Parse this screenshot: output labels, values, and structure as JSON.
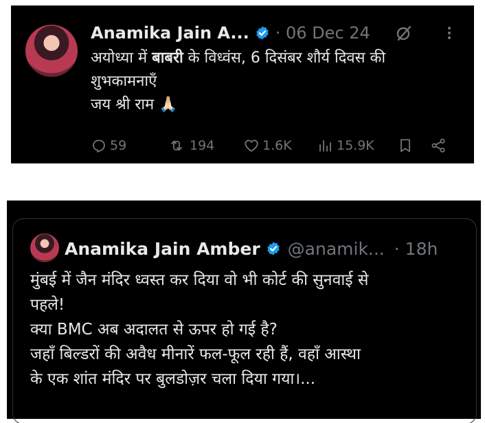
{
  "tweet1": {
    "display_name": "Anamika Jain A...",
    "dot_date": "· 06 Dec 24",
    "text_line1_pre": "अयोध्या में ",
    "text_line1_bold": "बाबरी",
    "text_line1_post": " के विध्वंस, 6 दिसंबर शौर्य दिवस की",
    "text_line2": "शुभकामनाएँ",
    "text_line3": "जय श्री राम 🙏🏻",
    "replies": "59",
    "reposts": "194",
    "likes": "1.6K",
    "views": "15.9K",
    "icons": {
      "reply": "reply-icon",
      "repost": "repost-icon",
      "like": "heart-icon",
      "views": "views-chart-icon",
      "bookmark": "bookmark-icon",
      "share": "share-icon",
      "grok": "grok-icon",
      "more": "more-icon",
      "verified": "verified-badge-icon"
    }
  },
  "tweet2": {
    "display_name": "Anamika Jain Amber",
    "handle": "@anamik...",
    "dot_date": "· 18h",
    "text_lines": [
      "मुंबई में जैन मंदिर ध्वस्त कर दिया वो भी कोर्ट की सुनवाई से",
      "पहले!",
      "क्या BMC अब अदालत से ऊपर हो गई है?",
      "जहाँ बिल्डरों की अवैध मीनारें फल-फूल रही हैं, वहाँ आस्था",
      "के एक शांत मंदिर पर बुलडोज़र चला दिया गया।..."
    ]
  },
  "colors": {
    "background": "#000000",
    "text": "#e7e9ea",
    "muted": "#71767b",
    "verified_blue": "#1d9bf0"
  }
}
